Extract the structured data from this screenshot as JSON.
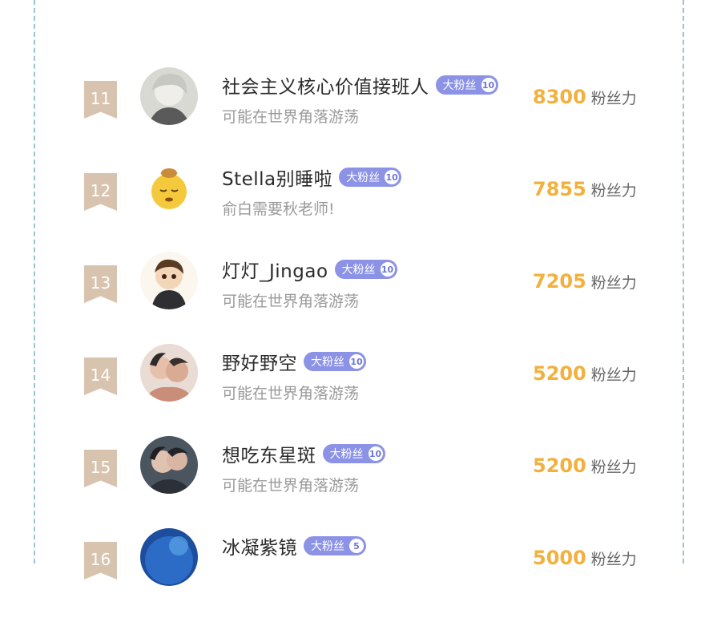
{
  "badge_label": "大粉丝",
  "entries": [
    {
      "rank": "11",
      "name": "社会主义核心价值接班人",
      "level": "10",
      "status": "可能在世界角落游荡",
      "score": "8300",
      "unit": "粉丝力",
      "avatar_icon": "anime-white-hair-avatar"
    },
    {
      "rank": "12",
      "name": "Stella别睡啦",
      "level": "10",
      "status": "俞白需要秋老师!",
      "score": "7855",
      "unit": "粉丝力",
      "avatar_icon": "sleepy-emoji-avatar"
    },
    {
      "rank": "13",
      "name": "灯灯_Jingao",
      "level": "10",
      "status": "可能在世界角落游荡",
      "score": "7205",
      "unit": "粉丝力",
      "avatar_icon": "chibi-boy-avatar"
    },
    {
      "rank": "14",
      "name": "野好野空",
      "level": "10",
      "status": "可能在世界角落游荡",
      "score": "5200",
      "unit": "粉丝力",
      "avatar_icon": "couple-art-avatar"
    },
    {
      "rank": "15",
      "name": "想吃东星斑",
      "level": "10",
      "status": "可能在世界角落游荡",
      "score": "5200",
      "unit": "粉丝力",
      "avatar_icon": "couple-dark-avatar"
    },
    {
      "rank": "16",
      "name": "冰凝紫镜",
      "level": "5",
      "status": "",
      "score": "5000",
      "unit": "粉丝力",
      "avatar_icon": "blue-water-avatar"
    }
  ],
  "colors": {
    "score": "#f2b13e",
    "badge": "#8c93e6",
    "rank": "#d8c4ae",
    "border": "#9cc3d4"
  }
}
